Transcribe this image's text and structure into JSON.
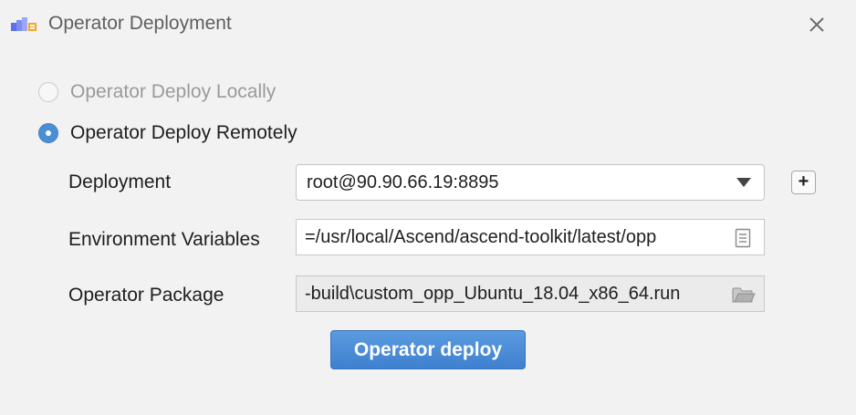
{
  "window": {
    "title": "Operator Deployment",
    "app_icon": "ascend-app-icon",
    "close_icon": "close-icon"
  },
  "deploy_mode": {
    "options": [
      {
        "label": "Operator Deploy Locally",
        "selected": false,
        "enabled": false
      },
      {
        "label": "Operator Deploy Remotely",
        "selected": true,
        "enabled": true
      }
    ]
  },
  "form": {
    "deployment": {
      "label": "Deployment",
      "value": "root@90.90.66.19:8895",
      "add_button_label": "+"
    },
    "env_vars": {
      "label": "Environment Variables",
      "value": "=/usr/local/Ascend/ascend-toolkit/latest/opp",
      "icon": "document-icon"
    },
    "operator_package": {
      "label": "Operator Package",
      "value": "-build\\custom_opp_Ubuntu_18.04_x86_64.run",
      "icon": "folder-icon"
    }
  },
  "actions": {
    "deploy_label": "Operator deploy"
  },
  "colors": {
    "accent": "#4a8fd6",
    "background": "#f2f2f2",
    "disabled_text": "#9a9a9a"
  }
}
